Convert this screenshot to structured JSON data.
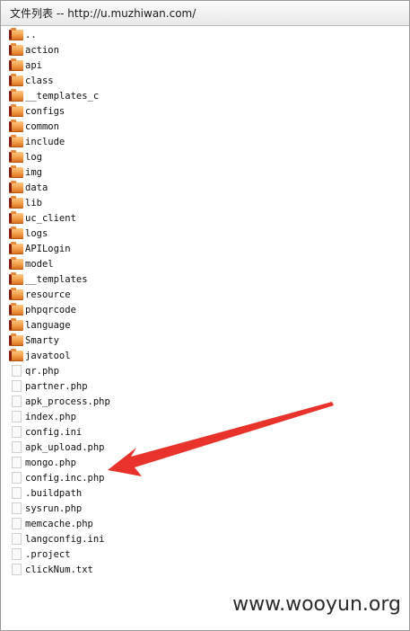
{
  "window": {
    "title": "文件列表 -- http://u.muzhiwan.com/"
  },
  "listing": {
    "items": [
      {
        "name": "..",
        "type": "folder"
      },
      {
        "name": "action",
        "type": "folder"
      },
      {
        "name": "api",
        "type": "folder"
      },
      {
        "name": "class",
        "type": "folder"
      },
      {
        "name": "__templates_c",
        "type": "folder"
      },
      {
        "name": "configs",
        "type": "folder"
      },
      {
        "name": "common",
        "type": "folder"
      },
      {
        "name": "include",
        "type": "folder"
      },
      {
        "name": "log",
        "type": "folder"
      },
      {
        "name": "img",
        "type": "folder"
      },
      {
        "name": "data",
        "type": "folder"
      },
      {
        "name": "lib",
        "type": "folder"
      },
      {
        "name": "uc_client",
        "type": "folder"
      },
      {
        "name": "logs",
        "type": "folder"
      },
      {
        "name": "APILogin",
        "type": "folder"
      },
      {
        "name": "model",
        "type": "folder"
      },
      {
        "name": "__templates",
        "type": "folder"
      },
      {
        "name": "resource",
        "type": "folder"
      },
      {
        "name": "phpqrcode",
        "type": "folder"
      },
      {
        "name": "language",
        "type": "folder"
      },
      {
        "name": "Smarty",
        "type": "folder"
      },
      {
        "name": "javatool",
        "type": "folder"
      },
      {
        "name": "qr.php",
        "type": "file"
      },
      {
        "name": "partner.php",
        "type": "file"
      },
      {
        "name": "apk_process.php",
        "type": "file"
      },
      {
        "name": "index.php",
        "type": "file"
      },
      {
        "name": "config.ini",
        "type": "file"
      },
      {
        "name": "apk_upload.php",
        "type": "file"
      },
      {
        "name": "mongo.php",
        "type": "file"
      },
      {
        "name": "config.inc.php",
        "type": "file"
      },
      {
        "name": ".buildpath",
        "type": "file"
      },
      {
        "name": "sysrun.php",
        "type": "file"
      },
      {
        "name": "memcache.php",
        "type": "file"
      },
      {
        "name": "langconfig.ini",
        "type": "file"
      },
      {
        "name": ".project",
        "type": "file"
      },
      {
        "name": "clickNum.txt",
        "type": "file"
      }
    ],
    "highlighted_item": "config.inc.php"
  },
  "annotation": {
    "arrow_color": "#e8322b"
  },
  "watermark": {
    "text": "www.wooyun.org"
  }
}
